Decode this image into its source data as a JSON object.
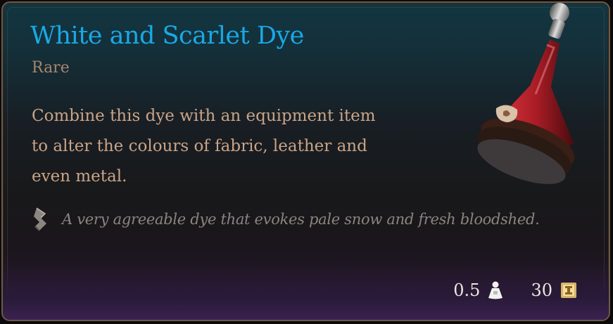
{
  "item": {
    "name": "White and Scarlet Dye",
    "rarity": "Rare",
    "description_lines": [
      "Combine this dye with an equipment item",
      "to alter the colours of fabric, leather and",
      "even metal."
    ],
    "flavor_text": "A very agreeable dye that evokes pale snow and fresh bloodshed.",
    "weight": "0.5",
    "value": "30"
  },
  "icons": {
    "flavor": "quill-icon",
    "weight": "weight-icon",
    "value": "gold-coin-icon",
    "item_art": "dye-bottle-icon"
  },
  "colors": {
    "title": "#19a9e6",
    "rarity": "#a7866c",
    "description": "#c9a487",
    "flavor": "#8b8580",
    "stats": "#ece6de"
  }
}
